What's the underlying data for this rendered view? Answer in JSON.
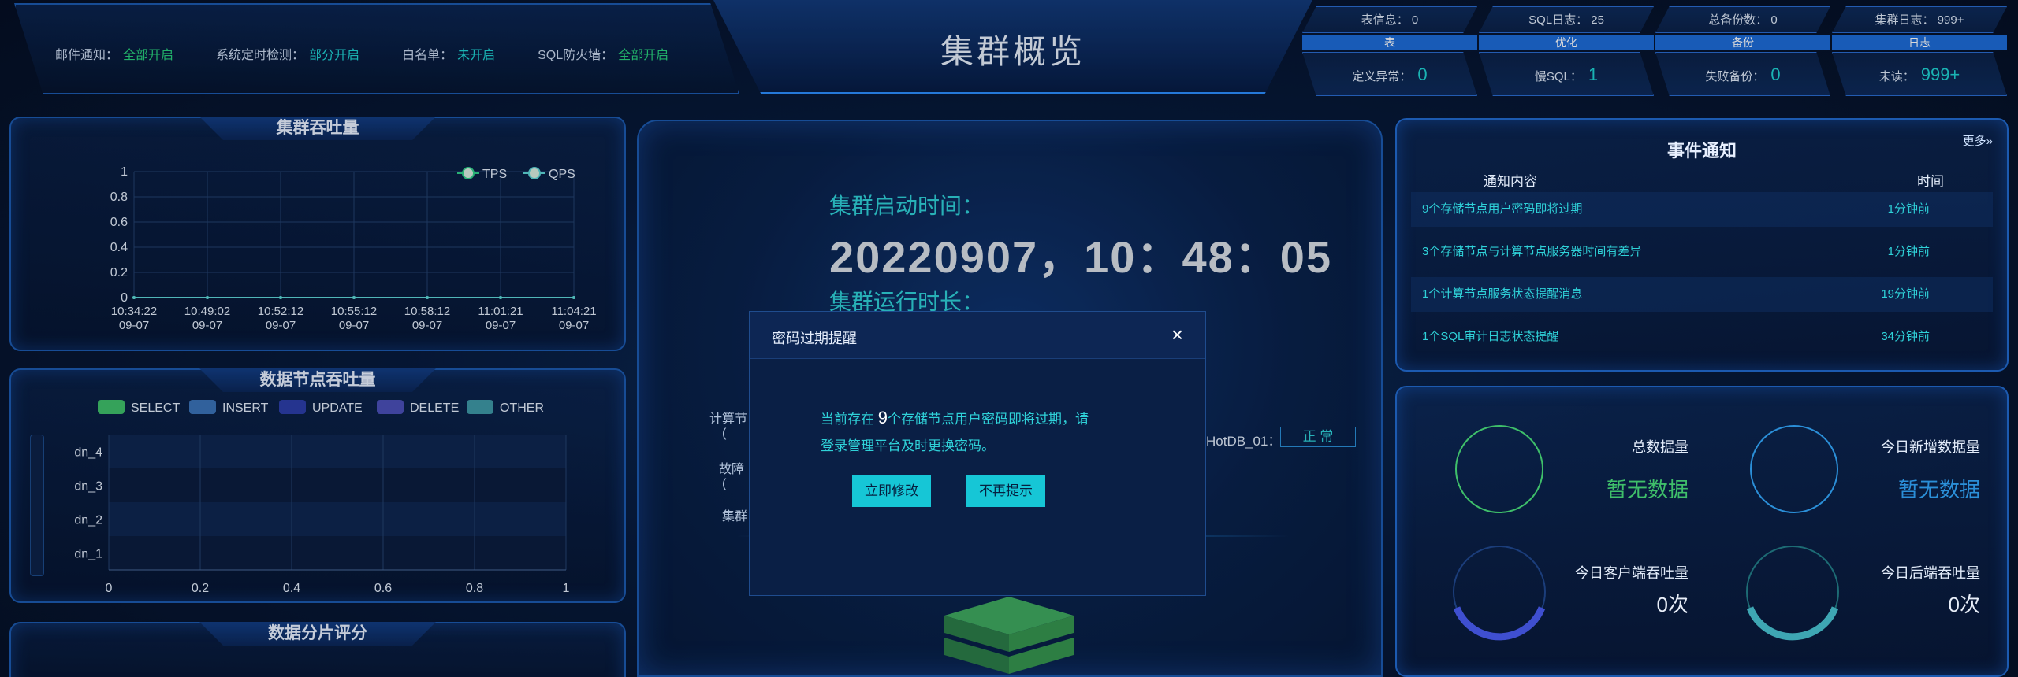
{
  "notices": [
    {
      "key": "邮件通知：",
      "value": "全部开启",
      "color": "#28d17c"
    },
    {
      "key": "系统定时检测：",
      "value": "部分开启",
      "color": "#1fd3d3"
    },
    {
      "key": "白名单：",
      "value": "未开启",
      "color": "#1fd3d3"
    },
    {
      "key": "SQL防火墙：",
      "value": "全部开启",
      "color": "#28d17c"
    }
  ],
  "page_title": "集群概览",
  "stat_cards": [
    {
      "top": "表信息： 0",
      "mid": "表",
      "bottom_label": "定义异常：",
      "bottom_value": "0"
    },
    {
      "top": "SQL日志： 25",
      "mid": "优化",
      "bottom_label": "慢SQL：",
      "bottom_value": "1"
    },
    {
      "top": "总备份数： 0",
      "mid": "备份",
      "bottom_label": "失败备份：",
      "bottom_value": "0"
    },
    {
      "top": "集群日志： 999+",
      "mid": "日志",
      "bottom_label": "未读：",
      "bottom_value": "999+"
    }
  ],
  "throughput_panel": {
    "title": "集群吞吐量",
    "legend": [
      "TPS",
      "QPS"
    ]
  },
  "datanode_panel": {
    "title": "数据节点吞吐量",
    "legend": [
      {
        "name": "SELECT",
        "color": "#3fbf6a"
      },
      {
        "name": "INSERT",
        "color": "#3a72b8"
      },
      {
        "name": "UPDATE",
        "color": "#2c3ea8"
      },
      {
        "name": "DELETE",
        "color": "#4a4fb8"
      },
      {
        "name": "OTHER",
        "color": "#3e98a6"
      }
    ]
  },
  "shard_panel": {
    "title": "数据分片评分"
  },
  "center": {
    "start_label": "集群启动时间：",
    "start_value": "20220907，10：48：05",
    "run_label": "集群运行时长：",
    "left_label_1": "计算节",
    "left_label_1b": "(",
    "left_label_2": "故障",
    "left_label_2b": "(",
    "left_label_3": "集群",
    "node_name": "HotDB_01：",
    "node_status": "正 常"
  },
  "modal": {
    "title": "密码过期提醒",
    "close": "×",
    "body_pre": "当前存在 ",
    "body_num": "9",
    "body_post": "个存储节点用户密码即将过期，请登录管理平台及时更换密码。",
    "btn_modify": "立即修改",
    "btn_dismiss": "不再提示"
  },
  "events": {
    "title": "事件通知",
    "more": "更多»",
    "col_content": "通知内容",
    "col_time": "时间",
    "rows": [
      {
        "text": "9个存储节点用户密码即将过期",
        "time": "1分钟前"
      },
      {
        "text": "3个存储节点与计算节点服务器时间有差异",
        "time": "1分钟前"
      },
      {
        "text": "1个计算节点服务状态提醒消息",
        "time": "19分钟前"
      },
      {
        "text": "1个SQL审计日志状态提醒",
        "time": "34分钟前"
      }
    ]
  },
  "data_stats": [
    {
      "label": "总数据量",
      "value": "暂无数据",
      "color": "#3fbf6a"
    },
    {
      "label": "今日新增数据量",
      "value": "暂无数据",
      "color": "#2b8fd8"
    },
    {
      "label": "今日客户端吞吐量",
      "value": "0次",
      "color": "#e8eef8"
    },
    {
      "label": "今日后端吞吐量",
      "value": "0次",
      "color": "#e8eef8"
    }
  ],
  "chart_data": [
    {
      "type": "line",
      "title": "集群吞吐量",
      "x": [
        "10:34:22\n09-07",
        "10:49:02\n09-07",
        "10:52:12\n09-07",
        "10:55:12\n09-07",
        "10:58:12\n09-07",
        "11:01:21\n09-07",
        "11:04:21\n09-07"
      ],
      "x_ticks": [
        "10:34:22",
        "10:49:02",
        "10:52:12",
        "10:55:12",
        "10:58:12",
        "11:01:21",
        "11:04:21"
      ],
      "x_ticks_date": "09-07",
      "y_ticks": [
        "0",
        "0.2",
        "0.4",
        "0.6",
        "0.8",
        "1"
      ],
      "ylim": [
        0,
        1
      ],
      "series": [
        {
          "name": "TPS",
          "values": [
            0,
            0,
            0,
            0,
            0,
            0,
            0
          ]
        },
        {
          "name": "QPS",
          "values": [
            0,
            0,
            0,
            0,
            0,
            0,
            0
          ]
        }
      ],
      "grid": true,
      "legend": "top-right"
    },
    {
      "type": "bar",
      "title": "数据节点吞吐量",
      "orientation": "horizontal",
      "categories": [
        "dn_4",
        "dn_3",
        "dn_2",
        "dn_1"
      ],
      "x_ticks": [
        "0",
        "0.2",
        "0.4",
        "0.6",
        "0.8",
        "1"
      ],
      "xlim": [
        0,
        1
      ],
      "series": [
        {
          "name": "SELECT",
          "values": [
            0,
            0,
            0,
            0
          ]
        },
        {
          "name": "INSERT",
          "values": [
            0,
            0,
            0,
            0
          ]
        },
        {
          "name": "UPDATE",
          "values": [
            0,
            0,
            0,
            0
          ]
        },
        {
          "name": "DELETE",
          "values": [
            0,
            0,
            0,
            0
          ]
        },
        {
          "name": "OTHER",
          "values": [
            0,
            0,
            0,
            0
          ]
        }
      ],
      "grid": true,
      "legend": "top"
    }
  ]
}
